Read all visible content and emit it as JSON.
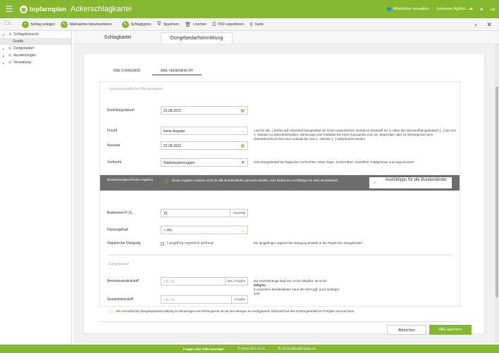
{
  "topbar": {
    "brand": "topfarmplan",
    "app_title": "Ackerschlagkartei",
    "user_link": "Mitarbeiter verwalten",
    "user_name": "Johannes Agrifor... ⏏"
  },
  "toolbar": {
    "items": [
      {
        "label": "Schlag anlegen",
        "icon": "plus-icon"
      },
      {
        "label": "Maßnahme dokumentieren",
        "icon": "pencil-icon"
      },
      {
        "label": "Schlagtyprox",
        "icon": "pencil-icon"
      },
      {
        "label": "Speichern",
        "icon": "save-icon"
      },
      {
        "label": "Löschen",
        "icon": "trash-icon"
      },
      {
        "label": "PDF exportieren",
        "icon": "pdf-icon"
      },
      {
        "label": "Karte",
        "icon": "map-pin-icon"
      }
    ]
  },
  "sidebar": {
    "items": [
      {
        "label": "Schlagübersicht",
        "expanded": true
      },
      {
        "label": "Gnade",
        "sub": true
      },
      {
        "label": "Düngebedarf"
      },
      {
        "label": "Auswertungen"
      },
      {
        "label": "Verwaltung"
      }
    ]
  },
  "tabs": [
    {
      "label": "Schlagkartei",
      "active": false
    },
    {
      "label": "Düngebedarfsermittlung",
      "active": true
    }
  ],
  "subtabs": [
    {
      "label": "DBE STANDARD",
      "active": false
    },
    {
      "label": "DBE VEREINFACHT",
      "active": true
    }
  ],
  "form": {
    "section1": "Landwirtschaftliche Pflichtangaben",
    "erstellungsdatum_label": "Erstellungsdatum",
    "erstellungsdatum_value": "22.08.2022",
    "frucht_label": "Frucht",
    "frucht_value": "keine Angabe",
    "aussaat_label": "Aussaat",
    "aussaat_value": "22.08.2022",
    "aussaat_info": "Laut für dk[...] dürfen auf Ackerland Düngemittel mit einem wesentlichen Gehalt an Stickstoff bis in Höhe des Stickstoffdüngebedarfs [...] bis zum 1. Oktober zu Zwischenfrüchten, Winterraps und Feldfutter bei einer Aussaat bis zum 15. September oder zu Wintergerste nach Getreidevorfrucht bei einer Aussaat bis zum 1. Oktober [...] aufgebracht werden.",
    "vorfrucht_label": "Vorfrucht",
    "vorfrucht_value": "Waldstaudenroggen",
    "vorfrucht_info": "Kein Düngebedarf bei folgenden Vorfrüchten: Mais, Raps, Zuckerrüben, Kartoffeln, Feldgemüse und Leguminosen.",
    "bundesland_label": "Bundeslandspezifische Angaben",
    "bundesland_msg": "Diese Angaben müssen nicht für alle Bundesländer gemacht werden. Hier findest Du Ausfülltipps für Dein Bundesland.",
    "tips_button": "Ausfülltipps für die Bundesländer",
    "bodenwert_label": "Bodenwert P₂O₅",
    "bodenwert_value": "15",
    "bodenwert_unit": "mg/100g",
    "humusgehalt_label": "Humusgehalt",
    "humusgehalt_value": "< 4%",
    "org_label": "Organische Düngung",
    "org_checkbox": "Langjährig organisch gedüngt",
    "org_info": "Ein langjähriger organischer Düngung besteht in der Regel kein Düngebedarf",
    "section2": "Düngebedarf",
    "ammonium_label": "Ammoniumstickstoff",
    "ammonium_placeholder": "z.B. 30",
    "ammonium_unit": "NH₄-N kg/ha",
    "gesamt_label": "Gesamtstickstoff",
    "gesamt_placeholder": "z.B. 60",
    "gesamt_unit": "N kg/ha",
    "duenge_info_1": "Die Höchstmenge liegt NH₄-N bei 30kg/ha, für N bei",
    "duenge_info_2": "60kg/ha.",
    "duenge_info_3": "In einzelnen Bundesländer kann der Wert ggf. auch niedriger",
    "duenge_info_4": "sein.",
    "bottom_note": "Die vereinfachte Düngebedarfsermittlung zu Winterraps und Wintergerste ist mit den Mengen an verfügbarem Stickstoff auf den N-Düngebedarf im Frühjahr anzurechnen."
  },
  "buttons": {
    "cancel": "Abbrechen",
    "save": "DBE speichern"
  },
  "footer": {
    "help": "Fragen oder Hilfe benötigt?",
    "phone": "02501 801 44 04",
    "email": "service@topfarmplan.de"
  },
  "colors": {
    "accent": "#86b82f",
    "dark_bar": "#6d6d6d"
  }
}
